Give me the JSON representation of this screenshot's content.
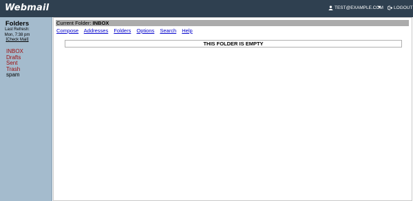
{
  "header": {
    "logo": "Webmail",
    "user_email": "TEST@EXAMPLE.COM",
    "logout_label": "LOGOUT",
    "icons": {
      "user": "user-icon",
      "dropdown": "caret-down-icon",
      "logout": "logout-icon"
    }
  },
  "sidebar": {
    "title": "Folders",
    "last_refresh_label": "Last Refresh:",
    "last_refresh_time": "Mon, 7:38 pm",
    "check_mail_label": "[Check Mail]",
    "folders": [
      {
        "label": "INBOX",
        "link": true
      },
      {
        "label": "Drafts",
        "link": true
      },
      {
        "label": "Sent",
        "link": true
      },
      {
        "label": "Trash",
        "link": true
      },
      {
        "label": "spam",
        "link": false
      }
    ]
  },
  "main": {
    "current_folder_label": "Current Folder:",
    "current_folder_name": "INBOX",
    "nav": [
      "Compose",
      "Addresses",
      "Folders",
      "Options",
      "Search",
      "Help"
    ],
    "empty_message": "THIS FOLDER IS EMPTY"
  },
  "colors": {
    "topbar": "#2f4050",
    "sidebar": "#a4bbcd",
    "folder_link": "#9c0c0c",
    "nav_link": "#0000cc",
    "folder_bar": "#ababab"
  }
}
